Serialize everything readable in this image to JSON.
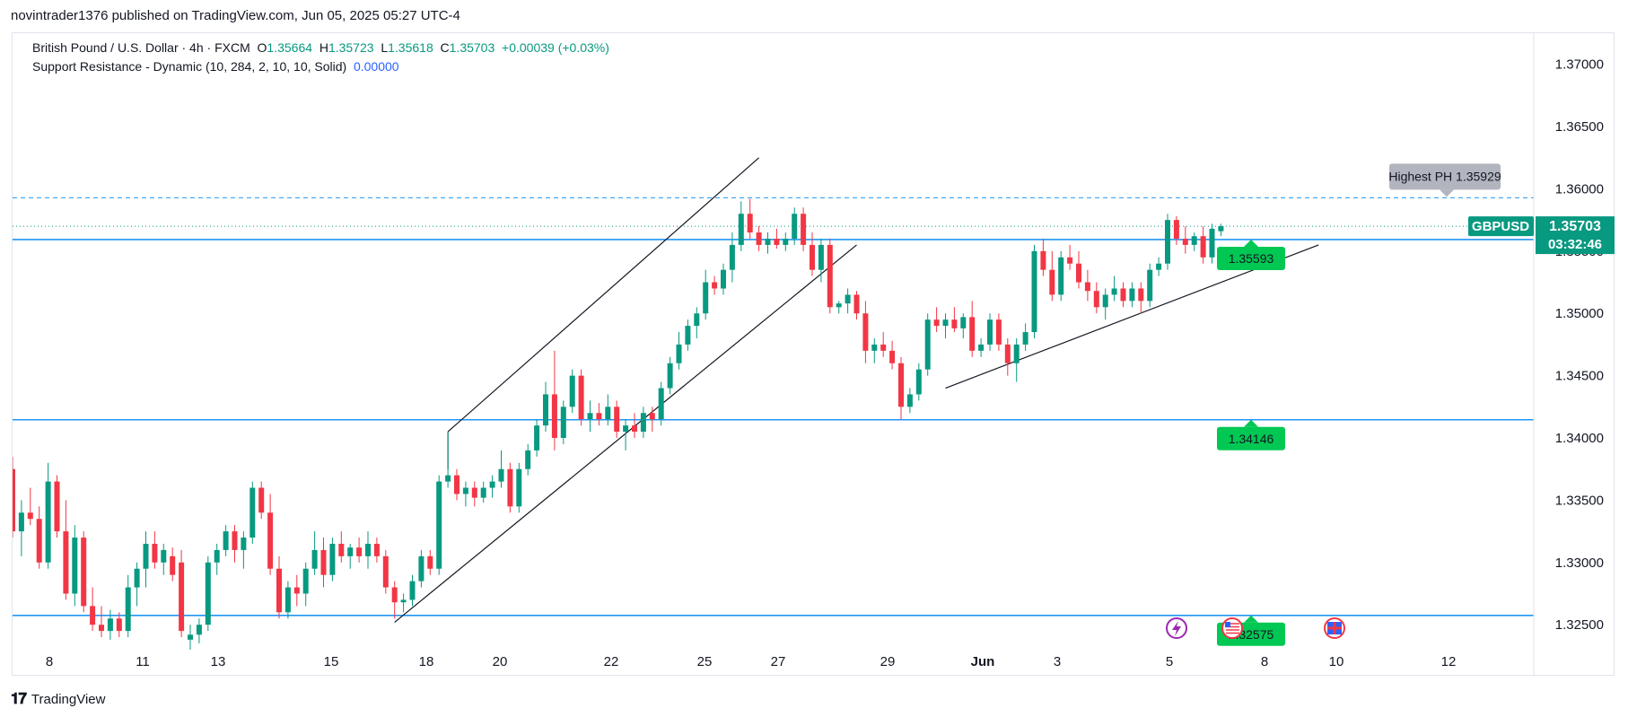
{
  "header": {
    "publish_line": "novintrader1376 published on TradingView.com, Jun 05, 2025 05:27 UTC-4"
  },
  "legend": {
    "symbol_line": "British Pound / U.S. Dollar · 4h · FXCM",
    "o_label": "O",
    "o_value": "1.35664",
    "h_label": "H",
    "h_value": "1.35723",
    "l_label": "L",
    "l_value": "1.35618",
    "c_label": "C",
    "c_value": "1.35703",
    "change": "+0.00039 (+0.03%)",
    "indicator": "Support Resistance - Dynamic (10, 284, 2, 10, 10, Solid)",
    "indicator_value": "0.00000"
  },
  "footer": {
    "brand": "TradingView"
  },
  "colors": {
    "up": "#089981",
    "down": "#f23645",
    "level": "#2196f3",
    "label_green": "#00c853",
    "badge_gray": "#b2b5be"
  },
  "chart_data": {
    "type": "candlestick",
    "symbol": "GBPUSD",
    "timeframe": "4h",
    "ylim": [
      1.3235,
      1.3725
    ],
    "y_ticks": [
      "1.37000",
      "1.36500",
      "1.36000",
      "1.35500",
      "1.35000",
      "1.34500",
      "1.34000",
      "1.33500",
      "1.33000",
      "1.32500"
    ],
    "x_ticks": [
      "8",
      "11",
      "13",
      "15",
      "18",
      "20",
      "22",
      "25",
      "27",
      "29",
      "Jun",
      "3",
      "5",
      "8",
      "10",
      "12"
    ],
    "current_price": "1.35703",
    "countdown": "03:32:46",
    "symbol_label": "GBPUSD",
    "support_levels": [
      {
        "value": 1.35593,
        "label": "1.35593"
      },
      {
        "value": 1.34146,
        "label": "1.34146"
      },
      {
        "value": 1.32575,
        "label": "1.32575"
      }
    ],
    "highest_ph": {
      "value": 1.35929,
      "label": "Highest PH 1.35929"
    },
    "candles": [
      [
        1.3375,
        1.3385,
        1.332,
        1.3325
      ],
      [
        1.3325,
        1.335,
        1.3305,
        1.334
      ],
      [
        1.334,
        1.336,
        1.333,
        1.3335
      ],
      [
        1.3335,
        1.3345,
        1.3295,
        1.33
      ],
      [
        1.33,
        1.338,
        1.3295,
        1.3365
      ],
      [
        1.3365,
        1.337,
        1.332,
        1.3325
      ],
      [
        1.3325,
        1.335,
        1.327,
        1.3275
      ],
      [
        1.3275,
        1.333,
        1.3265,
        1.332
      ],
      [
        1.332,
        1.3325,
        1.326,
        1.3265
      ],
      [
        1.3265,
        1.328,
        1.3245,
        1.325
      ],
      [
        1.325,
        1.3265,
        1.324,
        1.3245
      ],
      [
        1.3245,
        1.3262,
        1.3238,
        1.3255
      ],
      [
        1.3255,
        1.326,
        1.324,
        1.3245
      ],
      [
        1.3245,
        1.329,
        1.324,
        1.328
      ],
      [
        1.328,
        1.33,
        1.3265,
        1.3295
      ],
      [
        1.3295,
        1.3325,
        1.328,
        1.3315
      ],
      [
        1.3315,
        1.3325,
        1.3295,
        1.33
      ],
      [
        1.33,
        1.3315,
        1.329,
        1.331
      ],
      [
        1.3305,
        1.3312,
        1.3285,
        1.329
      ],
      [
        1.33,
        1.331,
        1.324,
        1.3245
      ],
      [
        1.3238,
        1.325,
        1.323,
        1.3242
      ],
      [
        1.3242,
        1.3255,
        1.3235,
        1.325
      ],
      [
        1.325,
        1.3305,
        1.3245,
        1.33
      ],
      [
        1.33,
        1.3315,
        1.329,
        1.331
      ],
      [
        1.331,
        1.333,
        1.3305,
        1.3325
      ],
      [
        1.3325,
        1.333,
        1.33,
        1.331
      ],
      [
        1.331,
        1.3325,
        1.3295,
        1.332
      ],
      [
        1.332,
        1.3365,
        1.3315,
        1.336
      ],
      [
        1.336,
        1.3365,
        1.3335,
        1.334
      ],
      [
        1.334,
        1.3355,
        1.329,
        1.3295
      ],
      [
        1.3295,
        1.3305,
        1.3255,
        1.326
      ],
      [
        1.326,
        1.3285,
        1.3255,
        1.328
      ],
      [
        1.328,
        1.329,
        1.3265,
        1.3275
      ],
      [
        1.3275,
        1.33,
        1.3265,
        1.3295
      ],
      [
        1.3295,
        1.3325,
        1.329,
        1.331
      ],
      [
        1.331,
        1.332,
        1.328,
        1.329
      ],
      [
        1.329,
        1.332,
        1.3285,
        1.3315
      ],
      [
        1.3315,
        1.3325,
        1.33,
        1.3305
      ],
      [
        1.3305,
        1.3315,
        1.3295,
        1.3312
      ],
      [
        1.3312,
        1.332,
        1.33,
        1.3305
      ],
      [
        1.3305,
        1.3325,
        1.3295,
        1.3315
      ],
      [
        1.3315,
        1.332,
        1.33,
        1.3305
      ],
      [
        1.3305,
        1.331,
        1.3275,
        1.328
      ],
      [
        1.328,
        1.3285,
        1.3255,
        1.3268
      ],
      [
        1.3268,
        1.3275,
        1.326,
        1.327
      ],
      [
        1.327,
        1.329,
        1.3265,
        1.3285
      ],
      [
        1.3285,
        1.331,
        1.328,
        1.3305
      ],
      [
        1.3305,
        1.331,
        1.329,
        1.3295
      ],
      [
        1.3295,
        1.337,
        1.329,
        1.3365
      ],
      [
        1.3365,
        1.3405,
        1.336,
        1.337
      ],
      [
        1.337,
        1.3375,
        1.335,
        1.3355
      ],
      [
        1.3355,
        1.3365,
        1.3345,
        1.336
      ],
      [
        1.336,
        1.3365,
        1.3345,
        1.3352
      ],
      [
        1.3352,
        1.3365,
        1.3348,
        1.336
      ],
      [
        1.336,
        1.337,
        1.3352,
        1.3365
      ],
      [
        1.3365,
        1.339,
        1.336,
        1.3375
      ],
      [
        1.3375,
        1.338,
        1.334,
        1.3345
      ],
      [
        1.3345,
        1.338,
        1.334,
        1.3375
      ],
      [
        1.3375,
        1.3395,
        1.337,
        1.339
      ],
      [
        1.339,
        1.3415,
        1.3385,
        1.341
      ],
      [
        1.341,
        1.3445,
        1.3405,
        1.3435
      ],
      [
        1.3435,
        1.347,
        1.339,
        1.34
      ],
      [
        1.34,
        1.343,
        1.3395,
        1.3425
      ],
      [
        1.3425,
        1.3455,
        1.342,
        1.345
      ],
      [
        1.345,
        1.3455,
        1.341,
        1.3415
      ],
      [
        1.3415,
        1.343,
        1.3405,
        1.342
      ],
      [
        1.342,
        1.3428,
        1.341,
        1.3415
      ],
      [
        1.3415,
        1.3435,
        1.341,
        1.3425
      ],
      [
        1.3425,
        1.343,
        1.34,
        1.3405
      ],
      [
        1.3405,
        1.3415,
        1.339,
        1.341
      ],
      [
        1.341,
        1.342,
        1.34,
        1.3405
      ],
      [
        1.3405,
        1.3425,
        1.34,
        1.342
      ],
      [
        1.342,
        1.3425,
        1.3405,
        1.3415
      ],
      [
        1.3415,
        1.3445,
        1.341,
        1.344
      ],
      [
        1.344,
        1.3465,
        1.3435,
        1.346
      ],
      [
        1.346,
        1.3485,
        1.3455,
        1.3475
      ],
      [
        1.3475,
        1.3495,
        1.347,
        1.349
      ],
      [
        1.349,
        1.3505,
        1.348,
        1.35
      ],
      [
        1.35,
        1.3535,
        1.3495,
        1.3525
      ],
      [
        1.3525,
        1.353,
        1.3515,
        1.352
      ],
      [
        1.352,
        1.354,
        1.3515,
        1.3535
      ],
      [
        1.3535,
        1.3565,
        1.3525,
        1.3555
      ],
      [
        1.3555,
        1.359,
        1.355,
        1.358
      ],
      [
        1.358,
        1.3592,
        1.356,
        1.3565
      ],
      [
        1.3565,
        1.357,
        1.355,
        1.3555
      ],
      [
        1.3555,
        1.3565,
        1.3548,
        1.356
      ],
      [
        1.356,
        1.3568,
        1.3552,
        1.3555
      ],
      [
        1.3555,
        1.3565,
        1.355,
        1.356
      ],
      [
        1.356,
        1.3585,
        1.3555,
        1.358
      ],
      [
        1.358,
        1.3585,
        1.355,
        1.3555
      ],
      [
        1.3555,
        1.3565,
        1.353,
        1.3535
      ],
      [
        1.3535,
        1.356,
        1.3525,
        1.3555
      ],
      [
        1.3555,
        1.356,
        1.35,
        1.3505
      ],
      [
        1.3505,
        1.351,
        1.35,
        1.3508
      ],
      [
        1.3508,
        1.352,
        1.35,
        1.3515
      ],
      [
        1.3515,
        1.3518,
        1.3495,
        1.35
      ],
      [
        1.35,
        1.351,
        1.346,
        1.347
      ],
      [
        1.347,
        1.348,
        1.346,
        1.3475
      ],
      [
        1.3475,
        1.3485,
        1.3465,
        1.347
      ],
      [
        1.347,
        1.3478,
        1.3455,
        1.346
      ],
      [
        1.346,
        1.3465,
        1.3415,
        1.3425
      ],
      [
        1.3425,
        1.344,
        1.342,
        1.3435
      ],
      [
        1.3435,
        1.346,
        1.343,
        1.3455
      ],
      [
        1.3455,
        1.35,
        1.345,
        1.3495
      ],
      [
        1.3495,
        1.3505,
        1.3485,
        1.349
      ],
      [
        1.349,
        1.35,
        1.348,
        1.3495
      ],
      [
        1.3495,
        1.3505,
        1.3485,
        1.3488
      ],
      [
        1.3488,
        1.35,
        1.348,
        1.3497
      ],
      [
        1.3497,
        1.351,
        1.3465,
        1.347
      ],
      [
        1.347,
        1.348,
        1.3465,
        1.3475
      ],
      [
        1.3475,
        1.35,
        1.347,
        1.3495
      ],
      [
        1.3495,
        1.35,
        1.347,
        1.3475
      ],
      [
        1.3475,
        1.348,
        1.345,
        1.346
      ],
      [
        1.346,
        1.348,
        1.3445,
        1.3475
      ],
      [
        1.3475,
        1.3492,
        1.347,
        1.3485
      ],
      [
        1.3485,
        1.3555,
        1.348,
        1.355
      ],
      [
        1.355,
        1.356,
        1.353,
        1.3535
      ],
      [
        1.3535,
        1.355,
        1.351,
        1.3515
      ],
      [
        1.3515,
        1.355,
        1.351,
        1.3545
      ],
      [
        1.3545,
        1.3555,
        1.3535,
        1.354
      ],
      [
        1.354,
        1.355,
        1.352,
        1.3525
      ],
      [
        1.3525,
        1.3535,
        1.351,
        1.3518
      ],
      [
        1.3518,
        1.3525,
        1.35,
        1.3505
      ],
      [
        1.3505,
        1.352,
        1.3495,
        1.3515
      ],
      [
        1.3515,
        1.353,
        1.351,
        1.352
      ],
      [
        1.352,
        1.3525,
        1.3505,
        1.351
      ],
      [
        1.351,
        1.3525,
        1.3505,
        1.352
      ],
      [
        1.352,
        1.3525,
        1.35,
        1.351
      ],
      [
        1.351,
        1.354,
        1.3505,
        1.3535
      ],
      [
        1.3535,
        1.3545,
        1.353,
        1.354
      ],
      [
        1.354,
        1.358,
        1.3535,
        1.3575
      ],
      [
        1.3575,
        1.3578,
        1.3555,
        1.356
      ],
      [
        1.356,
        1.357,
        1.3548,
        1.3555
      ],
      [
        1.3555,
        1.3565,
        1.355,
        1.3562
      ],
      [
        1.3562,
        1.357,
        1.354,
        1.3545
      ],
      [
        1.3545,
        1.3572,
        1.354,
        1.3568
      ],
      [
        1.3566,
        1.3572,
        1.3562,
        1.357
      ]
    ]
  }
}
